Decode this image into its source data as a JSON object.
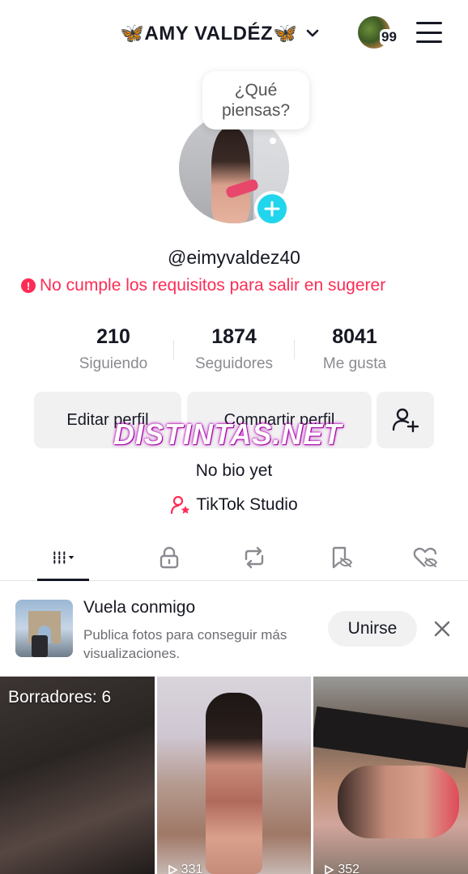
{
  "header": {
    "display_name": "🦋AMY VALDÉZ🦋",
    "notification_count": "99"
  },
  "profile": {
    "thought_bubble": "¿Qué piensas?",
    "handle": "@eimyvaldez40",
    "warning": "No cumple los requisitos para salir en sugerer",
    "stats": [
      {
        "value": "210",
        "label": "Siguiendo"
      },
      {
        "value": "1874",
        "label": "Seguidores"
      },
      {
        "value": "8041",
        "label": "Me gusta"
      }
    ],
    "edit_label": "Editar perfil",
    "share_label": "Compartir perfil",
    "bio": "No bio yet",
    "studio_label": "TikTok Studio"
  },
  "watermark": "DISTINTAS.NET",
  "tabs": [
    "videos-grid-icon",
    "lock-icon",
    "repost-icon",
    "saved-icon",
    "liked-icon"
  ],
  "promo": {
    "title": "Vuela conmigo",
    "description": "Publica fotos para conseguir más visualizaciones.",
    "join_label": "Unirse"
  },
  "grid": {
    "drafts_label": "Borradores: 6",
    "items": [
      {
        "views": ""
      },
      {
        "views": "331"
      },
      {
        "views": "352"
      }
    ]
  },
  "colors": {
    "accent_red": "#fe2c55",
    "accent_cyan": "#20d5ec",
    "text": "#161823",
    "muted": "#8a8b91"
  }
}
